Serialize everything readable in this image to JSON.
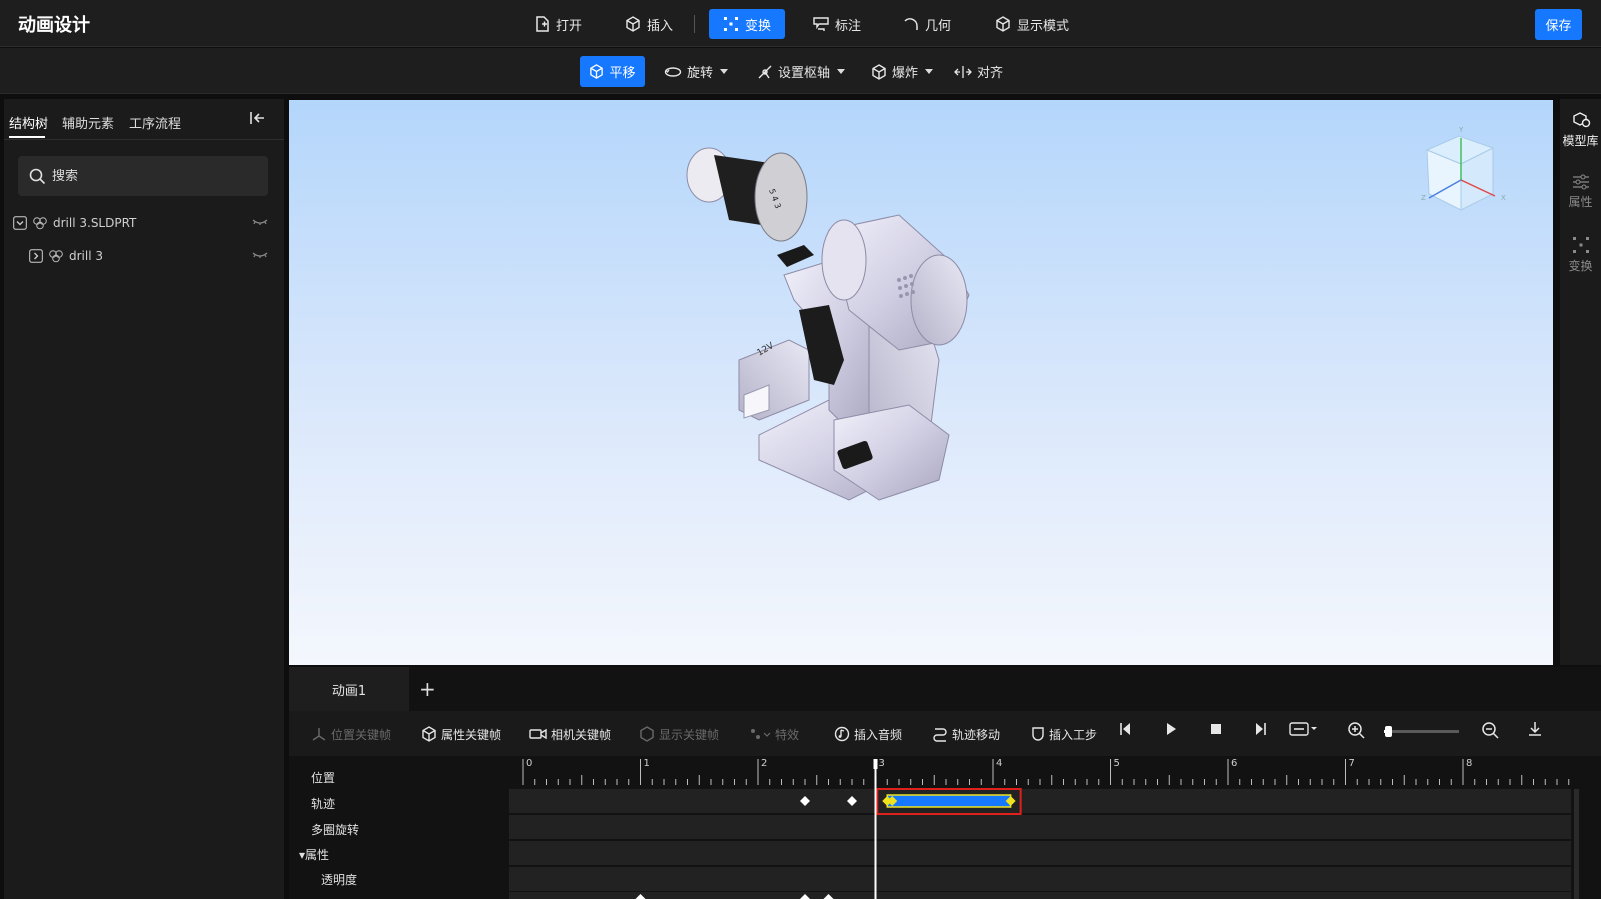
{
  "app": {
    "title": "动画设计",
    "save_label": "保存"
  },
  "toolbar": {
    "open": "打开",
    "insert": "插入",
    "transform": "变换",
    "annotate": "标注",
    "geometry": "几何",
    "display_mode": "显示模式"
  },
  "subtoolbar": {
    "translate": "平移",
    "rotate": "旋转",
    "set_pivot": "设置枢轴",
    "explode": "爆炸",
    "align": "对齐"
  },
  "left_panel": {
    "tabs": [
      "结构树",
      "辅助元素",
      "工序流程"
    ],
    "search_placeholder": "搜索",
    "tree": [
      {
        "label": "drill 3.SLDPRT",
        "expanded": true
      },
      {
        "label": "drill 3",
        "expanded": false
      }
    ]
  },
  "right_bar": {
    "model_library": "模型库",
    "properties": "属性",
    "transform": "变换"
  },
  "viewport": {
    "battery_label": "12V",
    "chuck_marks": "5 4 3"
  },
  "timeline": {
    "tab_label": "动画1",
    "add_label": "+",
    "tools": {
      "position_keyframe": "位置关键帧",
      "property_keyframe": "属性关键帧",
      "camera_keyframe": "相机关键帧",
      "display_keyframe": "显示关键帧",
      "effects": "特效",
      "insert_audio": "插入音频",
      "track_move": "轨迹移动",
      "insert_step": "插入工步"
    },
    "ruler_labels": [
      "0",
      "1",
      "2",
      "3",
      "4",
      "5",
      "6",
      "7",
      "8"
    ],
    "playhead_time": 3.0,
    "zoom_level": 0.05,
    "tracks": [
      {
        "name": "位置",
        "keyframes": [
          2.4,
          2.8
        ],
        "clip": [
          3.1,
          4.15
        ]
      },
      {
        "name": "轨迹"
      },
      {
        "name": "多圈旋转"
      },
      {
        "name": "▾属性"
      },
      {
        "name": "透明度",
        "keyframes": [
          1.0,
          2.4,
          2.6
        ]
      }
    ],
    "colors": {
      "clip": "#1677ff",
      "clip_keys": "#f2e21b",
      "highlight": "#e0201b"
    }
  }
}
